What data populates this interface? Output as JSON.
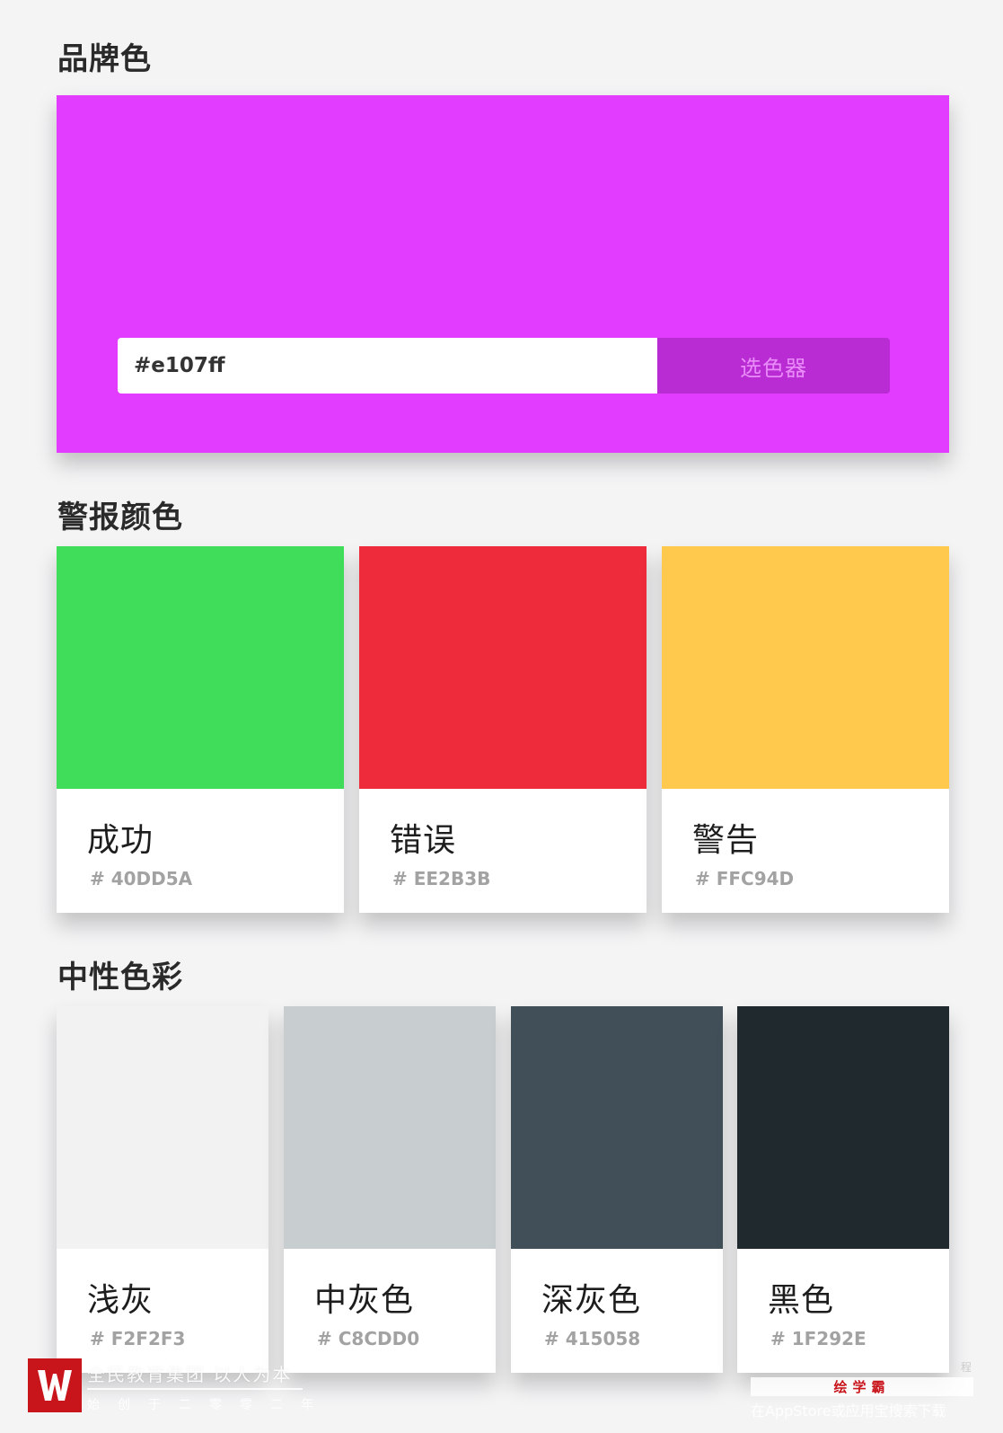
{
  "sections": {
    "brand_title": "品牌色",
    "alert_title": "警报颜色",
    "neutral_title": "中性色彩"
  },
  "brand": {
    "color": "#e13cff",
    "input_value": "#e107ff",
    "picker_label": "选色器"
  },
  "alerts": [
    {
      "name": "成功",
      "hex": "# 40DD5A",
      "color": "#40dd5a"
    },
    {
      "name": "错误",
      "hex": "# EE2B3B",
      "color": "#ee2b3b"
    },
    {
      "name": "警告",
      "hex": "# FFC94D",
      "color": "#ffc94d"
    }
  ],
  "neutrals": [
    {
      "name": "浅灰",
      "hex": "# F2F2F3",
      "color": "#f2f2f3"
    },
    {
      "name": "中灰色",
      "hex": "# C8CDD0",
      "color": "#c8cdd0"
    },
    {
      "name": "深灰色",
      "hex": "# 415058",
      "color": "#415058"
    },
    {
      "name": "黑色",
      "hex": "# 1F292E",
      "color": "#1f292e"
    }
  ],
  "watermark": {
    "left_text": "全民教育集团 以人为本",
    "left_sub": "始创于二零零二年",
    "right_title": "绘学霸",
    "right_sub": "在AppStore或应用宝搜索下载",
    "right_top": "程",
    "logo_color": "#c8141b"
  }
}
